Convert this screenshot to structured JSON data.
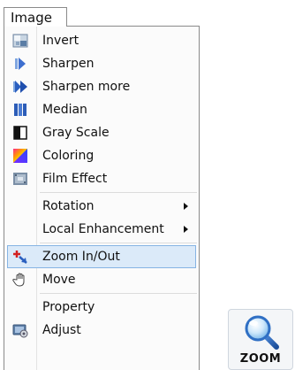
{
  "menubar": {
    "title": "Image"
  },
  "menu": {
    "items": [
      {
        "label": "Invert",
        "icon": "invert-icon"
      },
      {
        "label": "Sharpen",
        "icon": "sharpen-icon"
      },
      {
        "label": "Sharpen more",
        "icon": "sharpen-more-icon"
      },
      {
        "label": "Median",
        "icon": "median-icon"
      },
      {
        "label": "Gray Scale",
        "icon": "gray-scale-icon"
      },
      {
        "label": "Coloring",
        "icon": "coloring-icon"
      },
      {
        "label": "Film Effect",
        "icon": "film-effect-icon"
      },
      {
        "label": "Rotation",
        "submenu": true
      },
      {
        "label": "Local Enhancement",
        "submenu": true
      },
      {
        "label": "Zoom In/Out",
        "icon": "zoom-in-out-icon",
        "selected": true
      },
      {
        "label": "Move",
        "icon": "hand-icon"
      },
      {
        "label": "Property"
      },
      {
        "label": "Adjust",
        "icon": "adjust-icon"
      }
    ]
  },
  "toolbar": {
    "zoom_label": "ZOOM"
  },
  "colors": {
    "selection_fill": "#dbeaf9",
    "selection_border": "#86b4e4",
    "icon_blue": "#2a5fbf",
    "icon_red": "#d22020"
  }
}
